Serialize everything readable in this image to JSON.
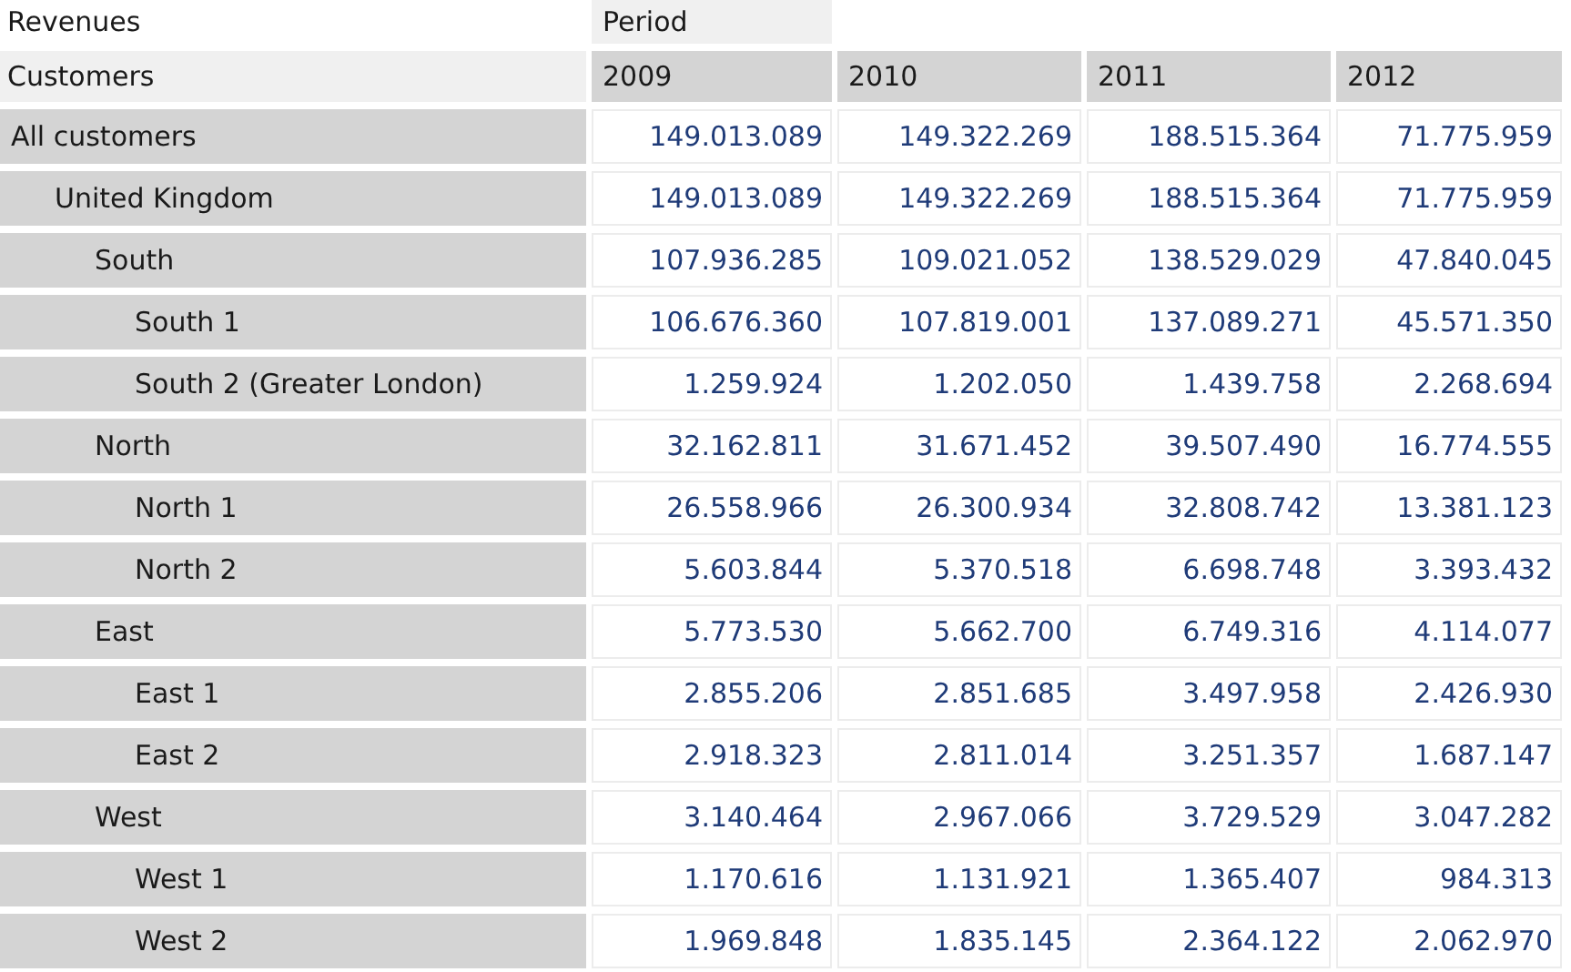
{
  "measure": "Revenues",
  "column_dimension": "Period",
  "row_dimension": "Customers",
  "columns": [
    "2009",
    "2010",
    "2011",
    "2012"
  ],
  "rows": [
    {
      "label": "All customers",
      "values": [
        "149.013.089",
        "149.322.269",
        "188.515.364",
        "71.775.959"
      ],
      "children": [
        {
          "label": "United Kingdom",
          "values": [
            "149.013.089",
            "149.322.269",
            "188.515.364",
            "71.775.959"
          ],
          "children": [
            {
              "label": "South",
              "values": [
                "107.936.285",
                "109.021.052",
                "138.529.029",
                "47.840.045"
              ],
              "children": [
                {
                  "label": "South 1",
                  "values": [
                    "106.676.360",
                    "107.819.001",
                    "137.089.271",
                    "45.571.350"
                  ]
                },
                {
                  "label": "South 2 (Greater London)",
                  "values": [
                    "1.259.924",
                    "1.202.050",
                    "1.439.758",
                    "2.268.694"
                  ]
                }
              ]
            },
            {
              "label": "North",
              "values": [
                "32.162.811",
                "31.671.452",
                "39.507.490",
                "16.774.555"
              ],
              "children": [
                {
                  "label": "North 1",
                  "values": [
                    "26.558.966",
                    "26.300.934",
                    "32.808.742",
                    "13.381.123"
                  ]
                },
                {
                  "label": "North 2",
                  "values": [
                    "5.603.844",
                    "5.370.518",
                    "6.698.748",
                    "3.393.432"
                  ]
                }
              ]
            },
            {
              "label": "East",
              "values": [
                "5.773.530",
                "5.662.700",
                "6.749.316",
                "4.114.077"
              ],
              "children": [
                {
                  "label": "East 1",
                  "values": [
                    "2.855.206",
                    "2.851.685",
                    "3.497.958",
                    "2.426.930"
                  ]
                },
                {
                  "label": "East 2",
                  "values": [
                    "2.918.323",
                    "2.811.014",
                    "3.251.357",
                    "1.687.147"
                  ]
                }
              ]
            },
            {
              "label": "West",
              "values": [
                "3.140.464",
                "2.967.066",
                "3.729.529",
                "3.047.282"
              ],
              "children": [
                {
                  "label": "West 1",
                  "values": [
                    "1.170.616",
                    "1.131.921",
                    "1.365.407",
                    "984.313"
                  ]
                },
                {
                  "label": "West 2",
                  "values": [
                    "1.969.848",
                    "1.835.145",
                    "2.364.122",
                    "2.062.970"
                  ]
                }
              ]
            }
          ]
        }
      ]
    }
  ]
}
